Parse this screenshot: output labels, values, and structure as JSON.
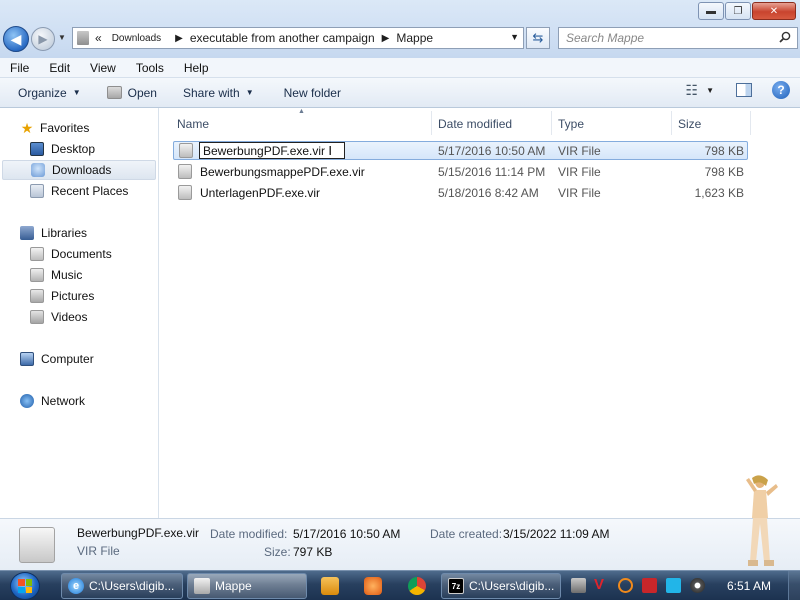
{
  "window": {
    "minimize_glyph": "▬",
    "maximize_glyph": "❐",
    "close_glyph": "✕"
  },
  "nav": {
    "back_glyph": "◀",
    "forward_glyph": "▶",
    "recent_glyph": "▼",
    "breadcrumb_prefix": "«",
    "breadcrumbs": [
      "Downloads",
      "executable from another campaign",
      "Mappe"
    ],
    "crumb_separator": "▶",
    "address_dropdown_glyph": "▼",
    "refresh_glyph": "⇆",
    "search_placeholder": "Search Mappe",
    "search_icon": "search-icon"
  },
  "menubar": {
    "items": [
      "File",
      "Edit",
      "View",
      "Tools",
      "Help"
    ]
  },
  "commandbar": {
    "organize": "Organize",
    "open": "Open",
    "share_with": "Share with",
    "new_folder": "New folder",
    "dropdown_glyph": "▼",
    "views_glyph": "☷",
    "help_glyph": "?"
  },
  "navpane": {
    "favorites": "Favorites",
    "desktop": "Desktop",
    "downloads": "Downloads",
    "recent_places": "Recent Places",
    "libraries": "Libraries",
    "documents": "Documents",
    "music": "Music",
    "pictures": "Pictures",
    "videos": "Videos",
    "computer": "Computer",
    "network": "Network",
    "star_glyph": "★"
  },
  "filelist": {
    "columns": {
      "name": "Name",
      "date_modified": "Date modified",
      "type": "Type",
      "size": "Size"
    },
    "sort_glyph": "▲",
    "rows": [
      {
        "name": "BewerbungPDF.exe.vir",
        "date": "5/17/2016 10:50 AM",
        "type": "VIR File",
        "size": "798 KB"
      },
      {
        "name": "BewerbungsmappePDF.exe.vir",
        "date": "5/15/2016 11:14 PM",
        "type": "VIR File",
        "size": "798 KB"
      },
      {
        "name": "UnterlagenPDF.exe.vir",
        "date": "5/18/2016 8:42 AM",
        "type": "VIR File",
        "size": "1,623 KB"
      }
    ],
    "ibeam_glyph": "I"
  },
  "details": {
    "filename": "BewerbungPDF.exe.vir",
    "filetype": "VIR File",
    "date_modified_label": "Date modified:",
    "date_modified_value": "5/17/2016 10:50 AM",
    "date_created_label": "Date created:",
    "date_created_value": "3/15/2022 11:09 AM",
    "size_label": "Size:",
    "size_value": "797 KB"
  },
  "taskbar": {
    "tasks": [
      {
        "label": "C:\\Users\\digib...",
        "icon": "ie-icon"
      },
      {
        "label": "Mappe",
        "icon": "folder-icon"
      },
      {
        "label": "C:\\Users\\digib...",
        "icon": "7zip-icon"
      }
    ],
    "ie_glyph": "e",
    "sevenzip_glyph": "7z",
    "clock": "6:51 AM"
  },
  "colors": {
    "accent": "#2a6bc4",
    "selection_border": "#84acdd",
    "taskbar": "#28405f"
  }
}
